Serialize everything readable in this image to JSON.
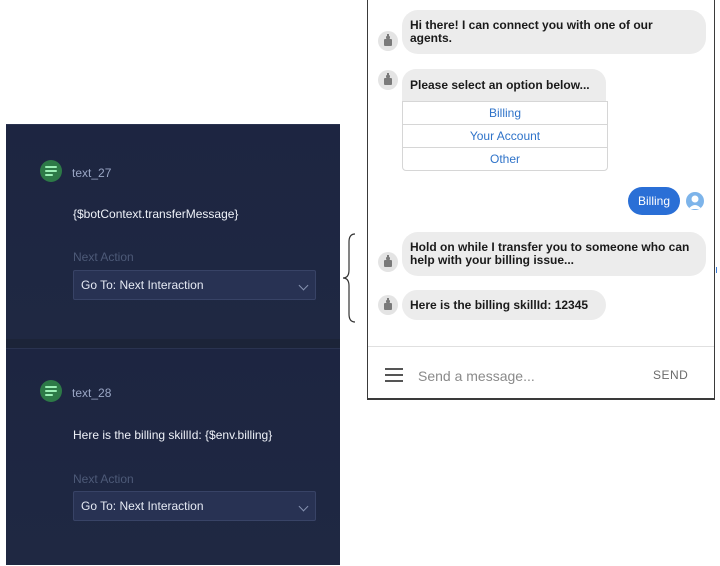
{
  "builder": {
    "nodes": [
      {
        "title": "text_27",
        "text": "{$botContext.transferMessage}",
        "next_action_label": "Next Action",
        "next_action_value": "Go To: Next Interaction"
      },
      {
        "title": "text_28",
        "text": "Here is the billing skillId: {$env.billing}",
        "next_action_label": "Next Action",
        "next_action_value": "Go To: Next Interaction"
      }
    ]
  },
  "chat": {
    "messages": {
      "greeting_line1": "Hi there! I can connect you with one of our",
      "greeting_line2": "agents.",
      "prompt": "Please select an option below...",
      "transfer_line1": "Hold on while I transfer you to someone who can",
      "transfer_line2": "help with your billing issue...",
      "skill": "Here is the billing skillId: 12345"
    },
    "options": [
      "Billing",
      "Your Account",
      "Other"
    ],
    "user_reply": "Billing",
    "composer": {
      "placeholder": "Send a message...",
      "send_label": "SEND"
    }
  },
  "icons": {
    "node": "text-node-icon",
    "bot": "bot-avatar-icon",
    "user": "user-avatar-icon",
    "menu": "menu-icon",
    "select": "chevron-down-icon"
  },
  "colors": {
    "builder_bg": "#1c2438",
    "node_icon": "#2d7a47",
    "user_bubble": "#2a6fd6",
    "option_link": "#2f73c9"
  }
}
